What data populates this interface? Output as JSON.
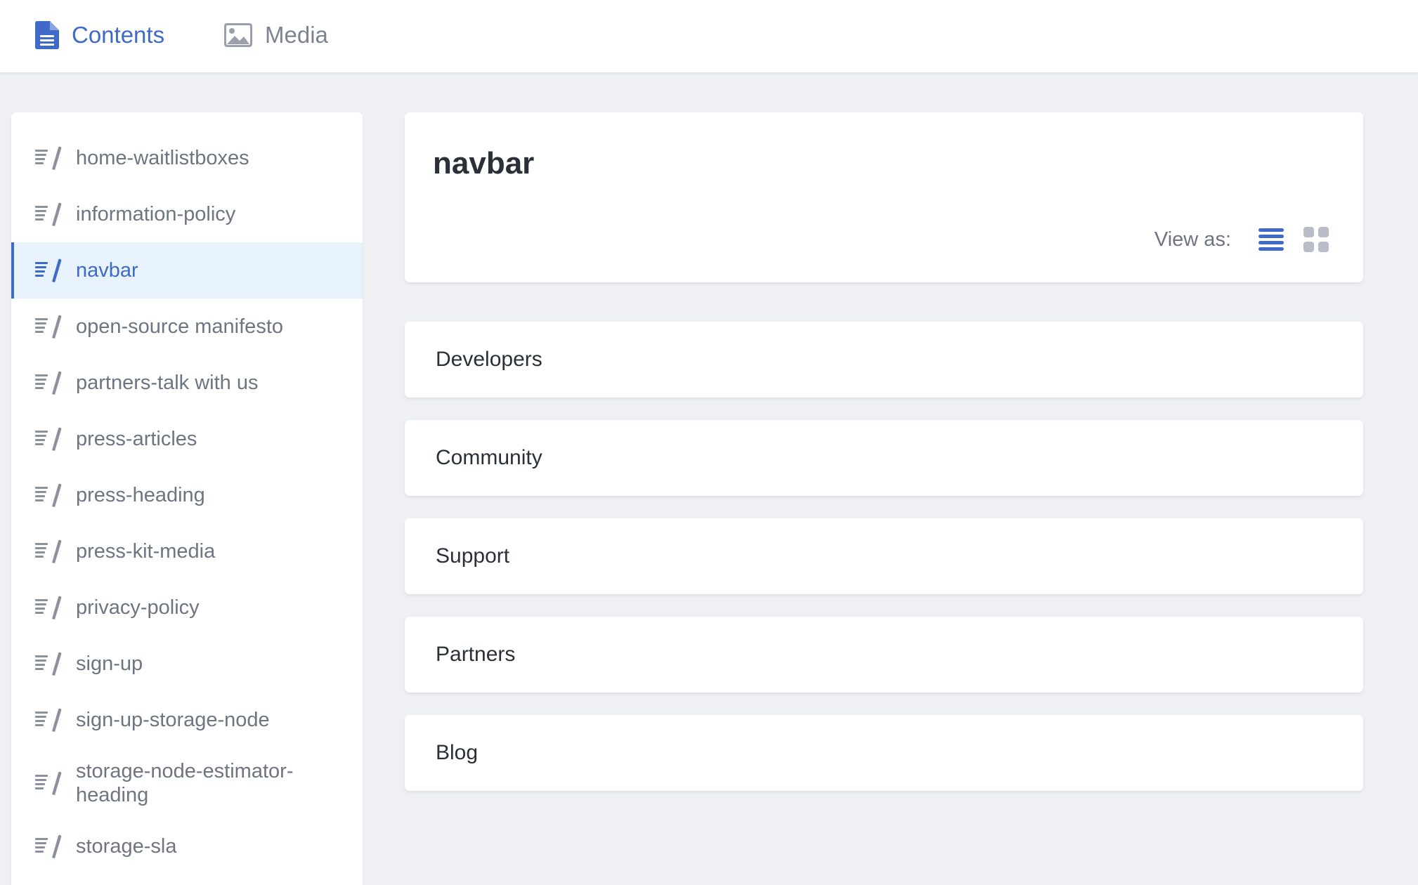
{
  "topbar": {
    "tabs": [
      {
        "label": "Contents",
        "icon": "document-icon",
        "active": true
      },
      {
        "label": "Media",
        "icon": "image-icon",
        "active": false
      }
    ]
  },
  "colors": {
    "accent": "#3f6ac7",
    "muted": "#7c8494",
    "active_bg": "#e8f2fd",
    "page_bg": "#eff0f4"
  },
  "sidebar": {
    "item_icon": "content-type-icon",
    "items": [
      {
        "label": "home-waitlistboxes",
        "active": false
      },
      {
        "label": "information-policy",
        "active": false
      },
      {
        "label": "navbar",
        "active": true
      },
      {
        "label": "open-source manifesto",
        "active": false
      },
      {
        "label": "partners-talk with us",
        "active": false
      },
      {
        "label": "press-articles",
        "active": false
      },
      {
        "label": "press-heading",
        "active": false
      },
      {
        "label": "press-kit-media",
        "active": false
      },
      {
        "label": "privacy-policy",
        "active": false
      },
      {
        "label": "sign-up",
        "active": false
      },
      {
        "label": "sign-up-storage-node",
        "active": false
      },
      {
        "label": "storage-node-estimator-heading",
        "active": false
      },
      {
        "label": "storage-sla",
        "active": false
      }
    ]
  },
  "main": {
    "title": "navbar",
    "view_as_label": "View as:",
    "view_modes": [
      {
        "name": "list",
        "icon": "list-view-icon",
        "active": true
      },
      {
        "name": "grid",
        "icon": "grid-view-icon",
        "active": false
      }
    ],
    "entries": [
      {
        "label": "Developers"
      },
      {
        "label": "Community"
      },
      {
        "label": "Support"
      },
      {
        "label": "Partners"
      },
      {
        "label": "Blog"
      }
    ]
  }
}
